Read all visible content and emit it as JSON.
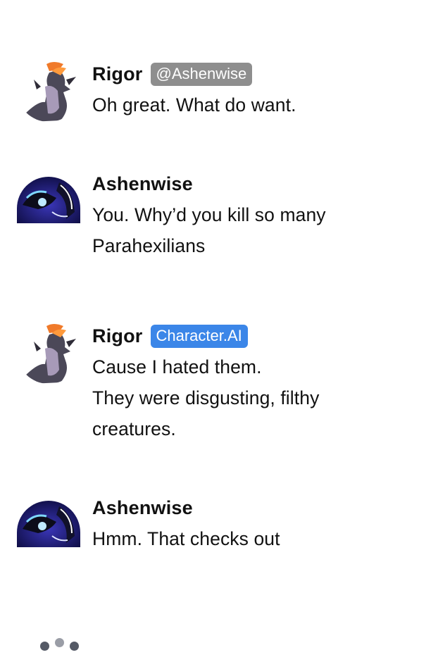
{
  "messages": [
    {
      "author": "Rigor",
      "tag": "@Ashenwise",
      "tag_color": "#8e8e8e",
      "lines": [
        "Oh great. What do want."
      ]
    },
    {
      "author": "Ashenwise",
      "lines": [
        "You. Why’d you kill so many",
        "Parahexilians"
      ]
    },
    {
      "author": "Rigor",
      "tag": "Character.AI",
      "tag_color": "#3b86e8",
      "lines": [
        "Cause I hated them.",
        "They were disgusting, filthy",
        "creatures."
      ]
    },
    {
      "author": "Ashenwise",
      "lines": [
        "Hmm. That checks out"
      ]
    }
  ],
  "typing_indicator": {
    "icon": "typing-dots-icon"
  }
}
